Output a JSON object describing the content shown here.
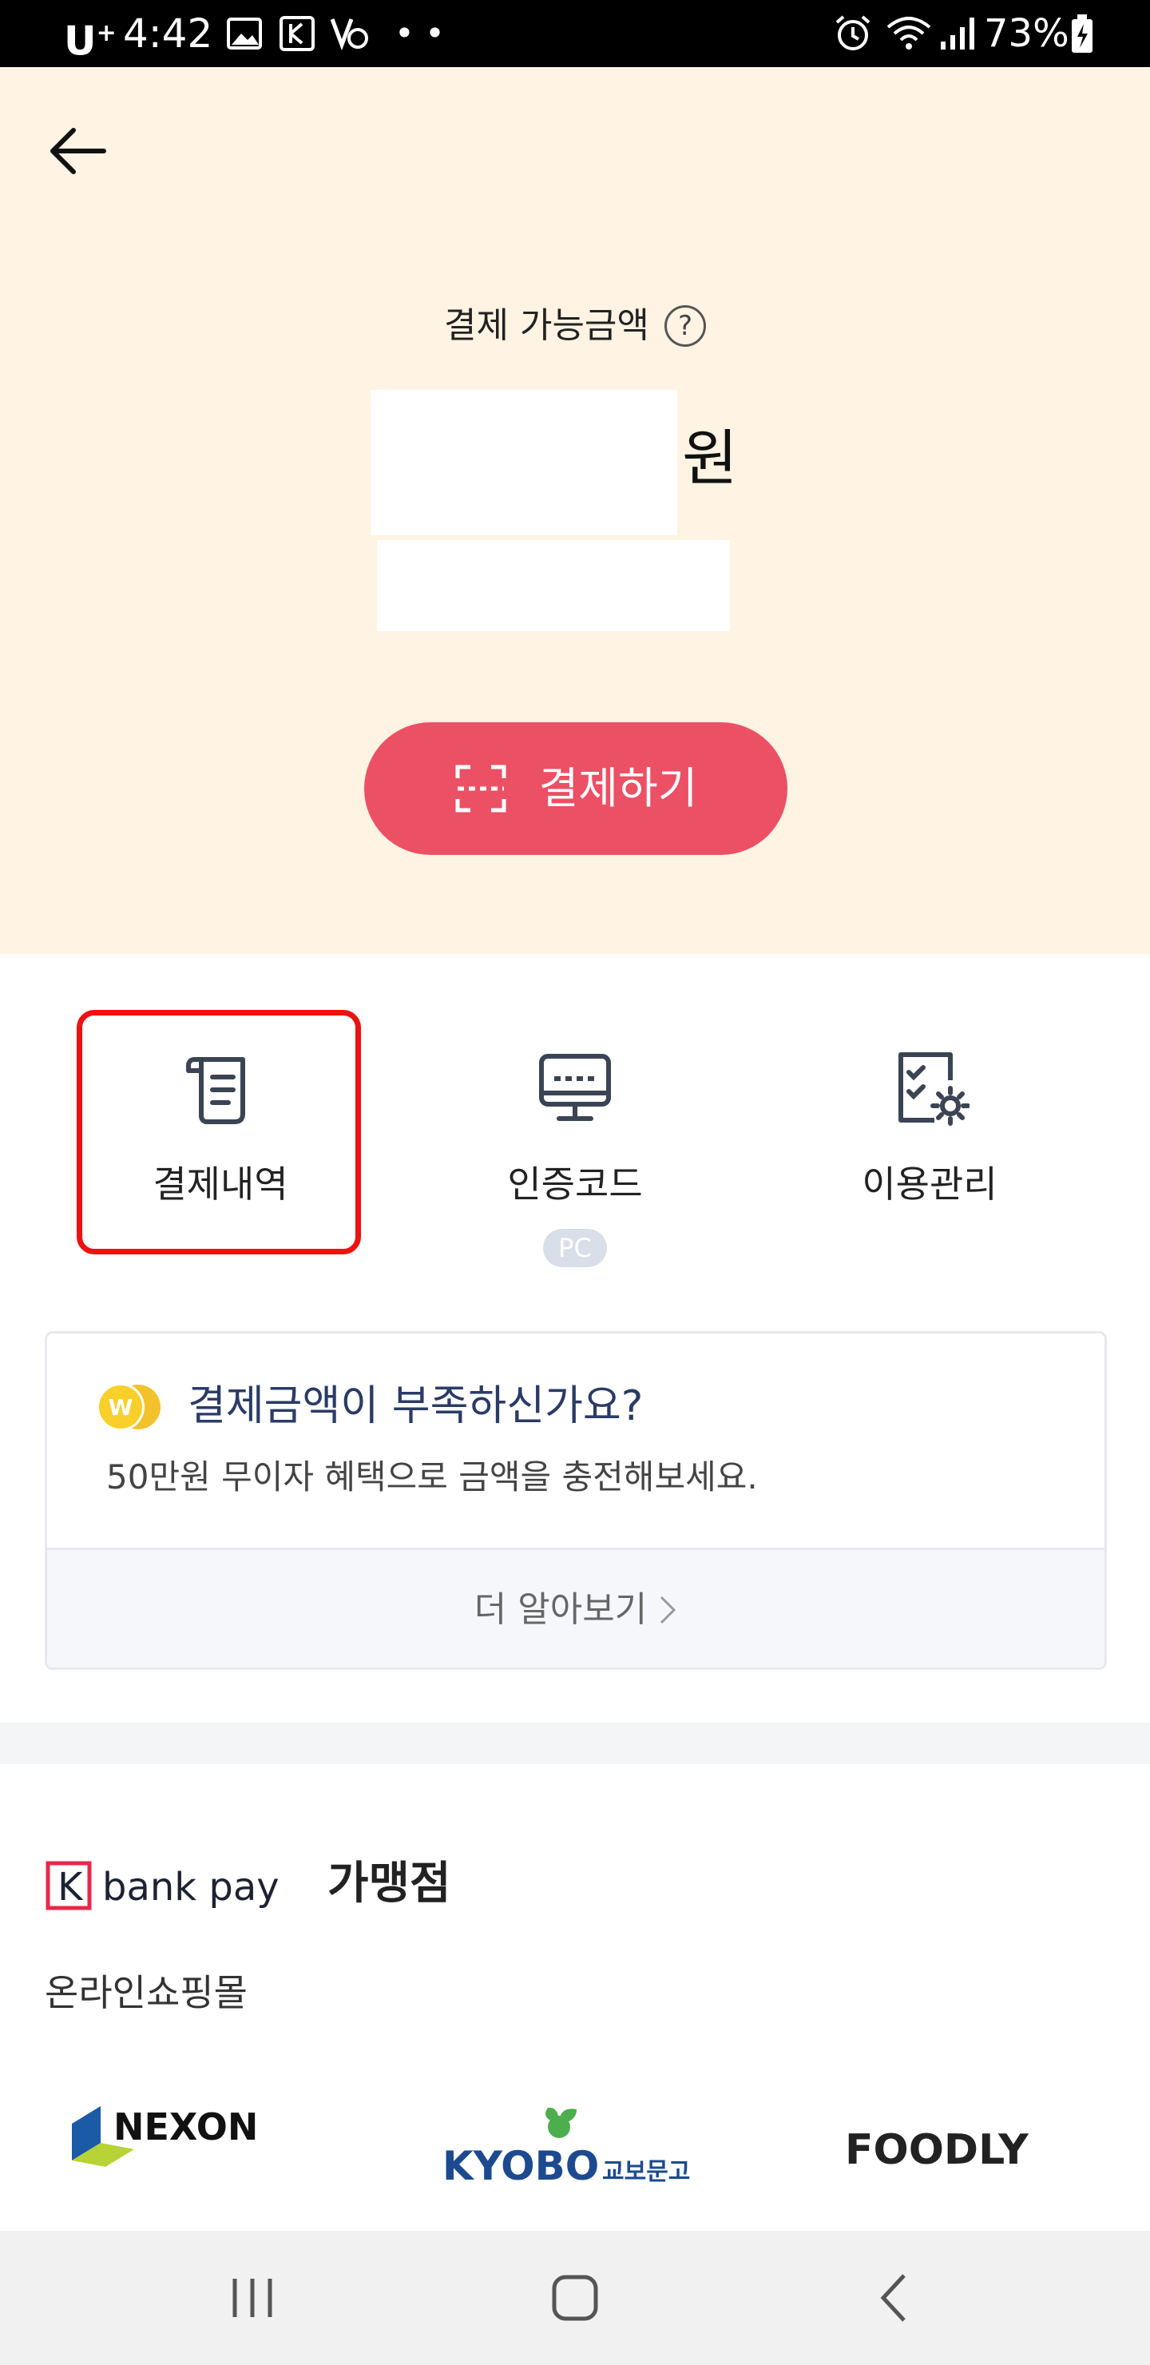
{
  "status_bar": {
    "carrier": "U",
    "carrier_plus": "+",
    "time": "4:42",
    "battery": "73%",
    "icons": [
      "image-icon",
      "k-app-icon",
      "vpn-key-icon",
      "more-dots-icon",
      "alarm-icon",
      "wifi-icon",
      "signal-icon",
      "battery-icon"
    ]
  },
  "header": {
    "back_icon": "back-arrow-icon"
  },
  "balance": {
    "label": "결제 가능금액",
    "help_symbol": "?",
    "currency": "원"
  },
  "pay_button": {
    "label": "결제하기",
    "icon": "scan-icon",
    "color": "#ec5064"
  },
  "menu": {
    "items": [
      {
        "label": "결제내역",
        "icon": "receipt-icon"
      },
      {
        "label": "인증코드",
        "icon": "monitor-icon",
        "badge": "PC"
      },
      {
        "label": "이용관리",
        "icon": "settings-checklist-icon"
      }
    ],
    "highlight_color": "#ee1111"
  },
  "promo": {
    "title": "결제금액이 부족하신가요?",
    "description": "50만원 무이자 혜택으로 금액을 충전해보세요.",
    "link": "더 알아보기",
    "icon": "won-coin-icon"
  },
  "merchants": {
    "brand_logo_text": "bank pay",
    "brand_mark": "K",
    "title": "가맹점",
    "category": "온라인쇼핑몰",
    "logos": [
      {
        "name": "NEXON"
      },
      {
        "name": "KYOBO",
        "sub": "교보문고"
      },
      {
        "name": "FOODLY"
      }
    ]
  },
  "nav_bar": {
    "buttons": [
      "recent-apps-icon",
      "home-icon",
      "back-icon"
    ]
  },
  "colors": {
    "top_background": "#fff3e3",
    "accent": "#ec5064",
    "promo_title": "#2a3b66"
  }
}
